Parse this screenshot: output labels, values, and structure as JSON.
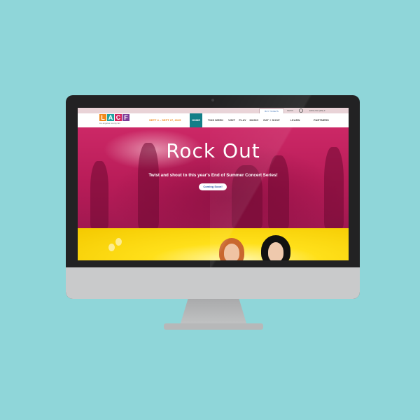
{
  "topbar": {
    "buy_tickets": "BUY TICKETS",
    "news": "NEWS",
    "language": "ENGLISH (EN) ▾"
  },
  "logo": {
    "letters": [
      "L",
      "A",
      "C",
      "F"
    ],
    "colors": [
      "#f08a1c",
      "#1fa3a0",
      "#d2245d",
      "#7e3c98"
    ],
    "tagline": "los angeles county fair"
  },
  "dates": "SEPT 4 – SEPT 27, 2015",
  "nav": {
    "items": [
      "HOME",
      "THIS WEEK",
      "VISIT",
      "PLAY",
      "MUSIC",
      "EAT + SHOP",
      "LEARN",
      "PARTNERS"
    ],
    "active": "HOME"
  },
  "hero": {
    "title": "Rock Out",
    "subtitle": "Twist and shout to this year's End of Summer Concert Series!",
    "button": "Coming Soon!",
    "slide_count": 4,
    "active_slide": 4
  },
  "colors": {
    "background": "#8fd6d9",
    "accent": "#127f88",
    "hero": "#c42462",
    "promo": "#ffe01a"
  },
  "icons": {
    "search": "search-icon",
    "camera": "camera-icon"
  }
}
